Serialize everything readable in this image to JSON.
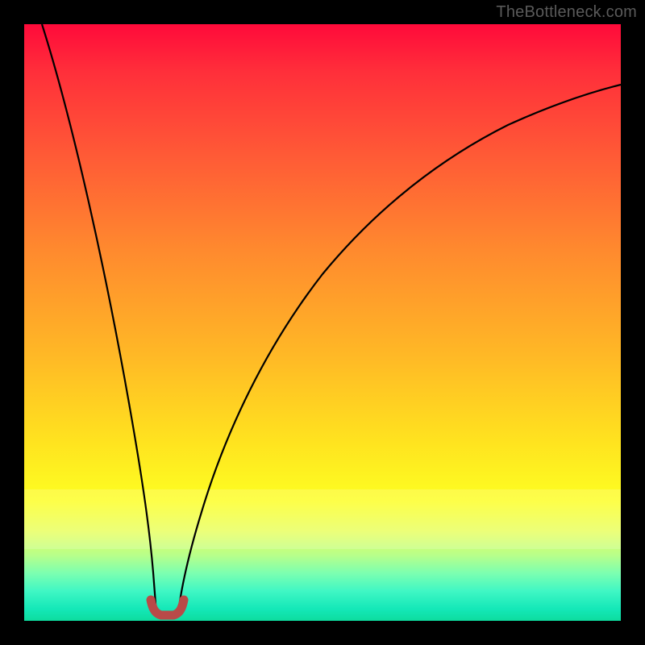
{
  "attribution": "TheBottleneck.com",
  "chart_data": {
    "type": "line",
    "title": "",
    "xlabel": "",
    "ylabel": "",
    "xlim": [
      0,
      100
    ],
    "ylim": [
      0,
      100
    ],
    "grid": false,
    "legend": false,
    "background_gradient": {
      "orientation": "vertical",
      "stops": [
        {
          "pos": 0,
          "color": "#ff0a3a"
        },
        {
          "pos": 38,
          "color": "#ff8a2e"
        },
        {
          "pos": 70,
          "color": "#ffe31f"
        },
        {
          "pos": 85,
          "color": "#e8ff5c"
        },
        {
          "pos": 100,
          "color": "#0ddc9e"
        }
      ]
    },
    "series": [
      {
        "name": "left-branch",
        "color": "#000000",
        "width": 2,
        "x": [
          3,
          5,
          8,
          11,
          14,
          17,
          19,
          20.5,
          21.5,
          22.2
        ],
        "y": [
          100,
          84,
          67,
          51,
          36,
          22,
          12,
          6,
          2.5,
          1
        ]
      },
      {
        "name": "right-branch",
        "color": "#000000",
        "width": 2,
        "x": [
          25.8,
          27,
          29,
          32,
          36,
          41,
          47,
          54,
          62,
          71,
          81,
          91,
          100
        ],
        "y": [
          1,
          3,
          8,
          16,
          27,
          39,
          50,
          59,
          67,
          74,
          80,
          84,
          87
        ]
      },
      {
        "name": "valley-marker",
        "color": "#b94a48",
        "width": 10,
        "x": [
          21.2,
          21.6,
          22.2,
          23.0,
          24.0,
          24.8,
          25.6,
          26.2,
          26.6
        ],
        "y": [
          3.5,
          2.2,
          1.3,
          0.9,
          0.8,
          0.9,
          1.3,
          2.2,
          3.5
        ]
      }
    ],
    "annotations": []
  }
}
